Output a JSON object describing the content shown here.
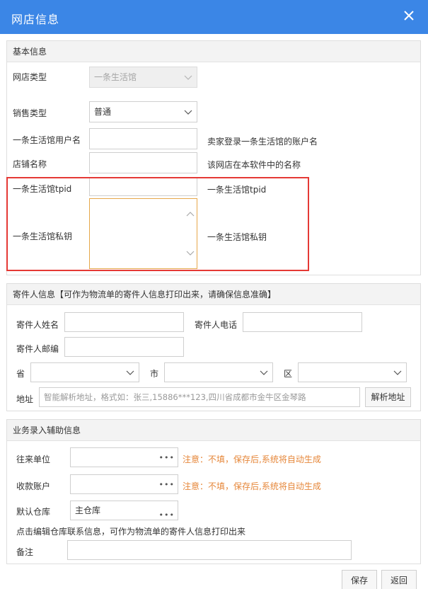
{
  "dialog": {
    "title": "网店信息"
  },
  "basic": {
    "section_title": "基本信息",
    "shop_type_label": "网店类型",
    "shop_type_value": "一条生活馆",
    "sales_type_label": "销售类型",
    "sales_type_value": "普通",
    "username_label": "一条生活馆用户名",
    "username_hint": "卖家登录一条生活馆的账户名",
    "shop_name_label": "店铺名称",
    "shop_name_hint": "该网店在本软件中的名称",
    "tpid_label": "一条生活馆tpid",
    "tpid_hint": "一条生活馆tpid",
    "key_label": "一条生活馆私钥",
    "key_hint": "一条生活馆私钥"
  },
  "sender": {
    "section_title": "寄件人信息【可作为物流单的寄件人信息打印出来，请确保信息准确】",
    "name_label": "寄件人姓名",
    "phone_label": "寄件人电话",
    "zip_label": "寄件人邮编",
    "province_label": "省",
    "city_label": "市",
    "district_label": "区",
    "address_label": "地址",
    "address_placeholder": "智能解析地址，格式如：张三,15886***123,四川省成都市金牛区金琴路",
    "parse_button": "解析地址"
  },
  "business": {
    "section_title": "业务录入辅助信息",
    "partner_label": "往来单位",
    "partner_note": "注意：不填，保存后,系统将自动生成",
    "account_label": "收款账户",
    "account_note": "注意：不填，保存后,系统将自动生成",
    "warehouse_label": "默认仓库",
    "warehouse_value": "主仓库",
    "warehouse_tip": "点击编辑仓库联系信息，可作为物流单的寄件人信息打印出来",
    "remark_label": "备注",
    "more_glyph": "•••"
  },
  "footer": {
    "save_label": "保存",
    "back_label": "返回"
  },
  "colors": {
    "titlebar": "#3b86e6",
    "note": "#e6873a",
    "highlight": "#e53935"
  }
}
